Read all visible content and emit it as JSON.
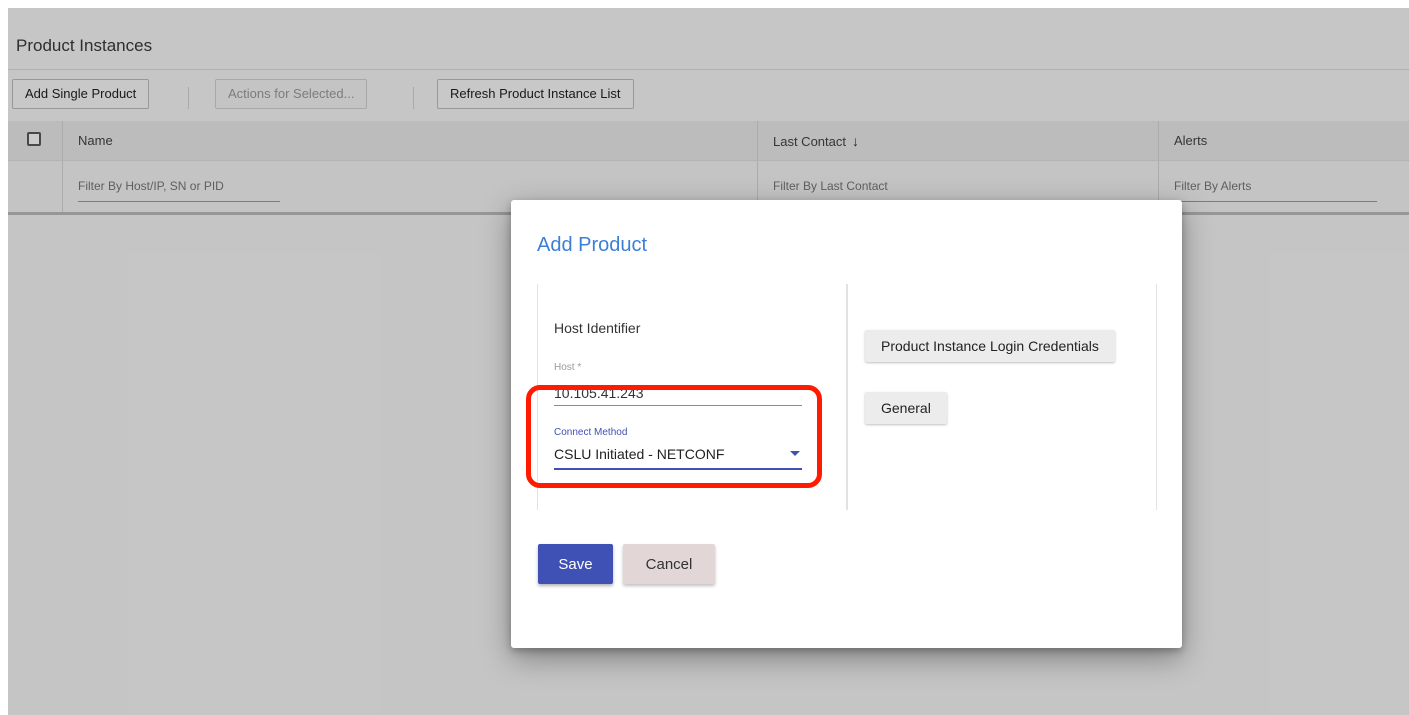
{
  "panel": {
    "title": "Product Instances"
  },
  "toolbar": {
    "add_single_product": "Add Single Product",
    "actions_for_selected": "Actions for Selected...",
    "refresh_list": "Refresh Product Instance List"
  },
  "table": {
    "columns": {
      "name": "Name",
      "last_contact": "Last Contact",
      "alerts": "Alerts"
    },
    "sort": {
      "column": "last_contact",
      "direction": "descending",
      "arrow": "↓"
    },
    "filters": {
      "name": "Filter By Host/IP, SN or PID",
      "last_contact": "Filter By Last Contact",
      "alerts": "Filter By Alerts"
    }
  },
  "dialog": {
    "title": "Add Product",
    "section_label": "Host Identifier",
    "host_label": "Host *",
    "host_value": "10.105.41.243",
    "connect_method_label": "Connect Method",
    "connect_method_value": "CSLU Initiated - NETCONF",
    "right_buttons": {
      "credentials": "Product Instance Login Credentials",
      "general": "General"
    },
    "save": "Save",
    "cancel": "Cancel"
  },
  "colors": {
    "accent": "#3f51b5",
    "title_blue": "#3d7fd4",
    "highlight_red": "#ff1a00",
    "cancel_bg": "#e2d6d6"
  }
}
